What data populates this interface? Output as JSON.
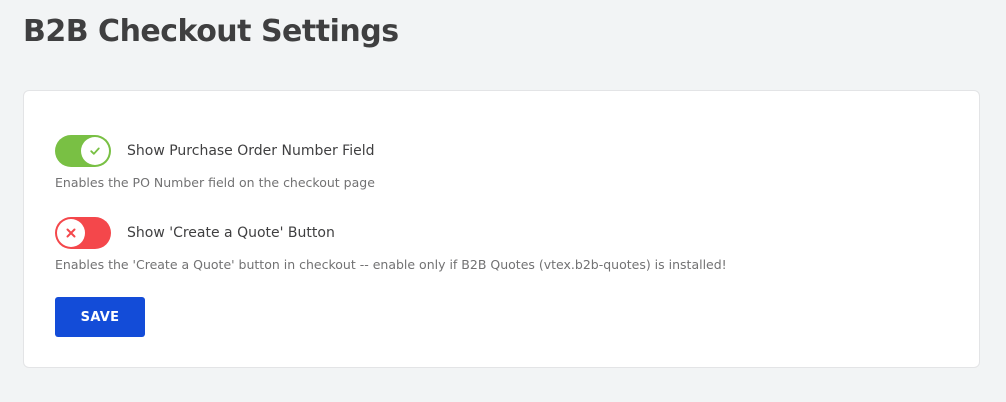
{
  "page": {
    "title": "B2B Checkout Settings"
  },
  "settings": {
    "po_number": {
      "label": "Show Purchase Order Number Field",
      "description": "Enables the PO Number field on the checkout page",
      "enabled": true
    },
    "create_quote": {
      "label": "Show 'Create a Quote' Button",
      "description": "Enables the 'Create a Quote' button in checkout -- enable only if B2B Quotes (vtex.b2b-quotes) is installed!",
      "enabled": false
    }
  },
  "actions": {
    "save_label": "SAVE"
  },
  "icons": {
    "toggle_on": "check-icon",
    "toggle_off": "close-icon"
  },
  "colors": {
    "toggle_on": "#79c044",
    "toggle_off": "#f4474b",
    "primary_button": "#134cd8",
    "background": "#f2f4f5"
  }
}
